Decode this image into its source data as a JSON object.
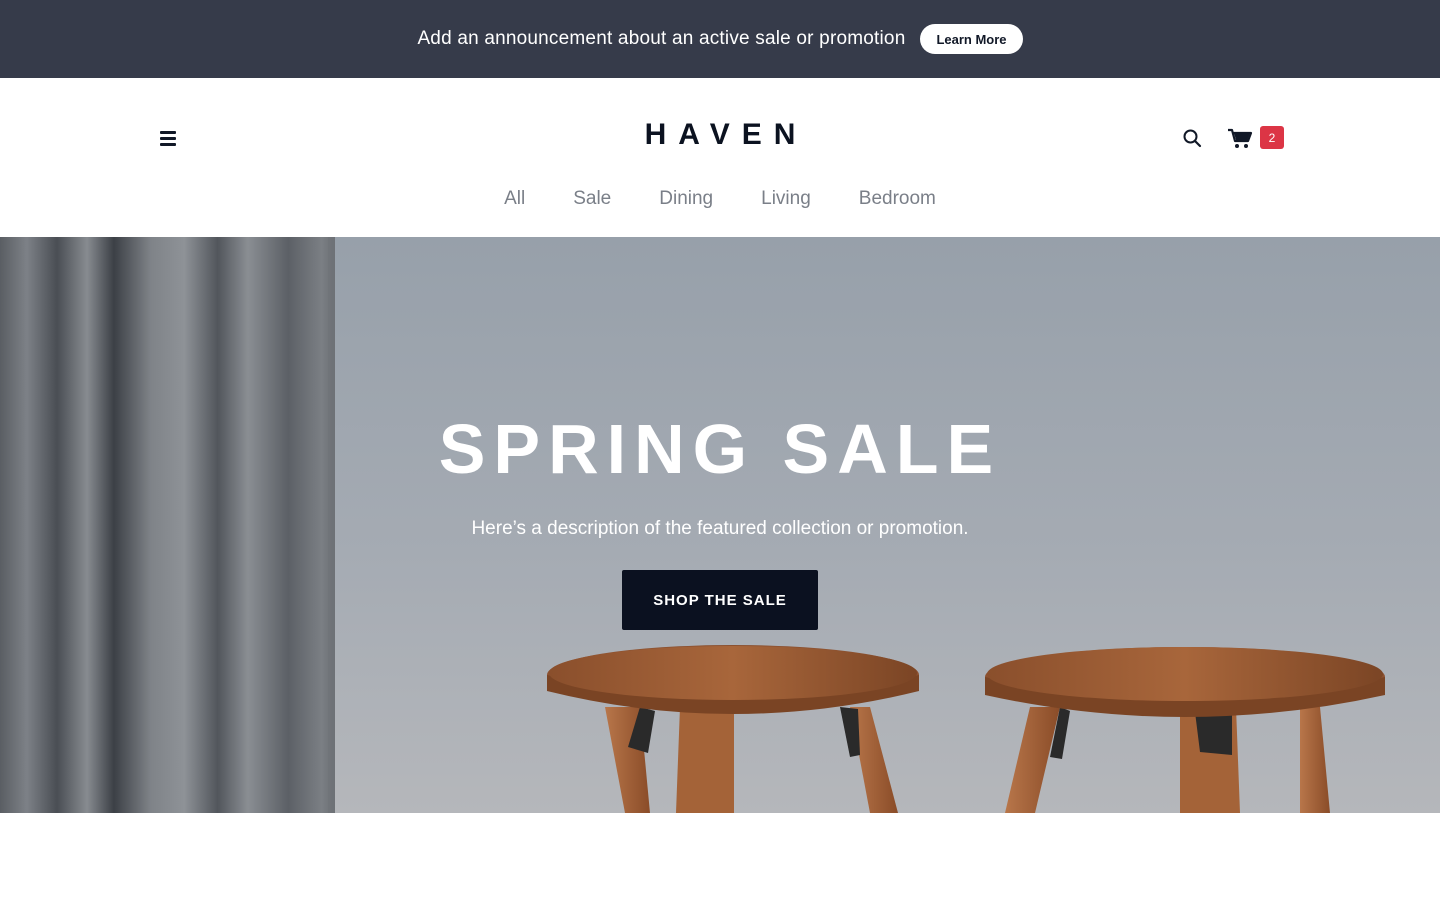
{
  "announcement": {
    "text": "Add an announcement about an active sale or promotion",
    "button_label": "Learn More"
  },
  "header": {
    "logo": "HAVEN",
    "cart_count": "2",
    "nav": [
      "All",
      "Sale",
      "Dining",
      "Living",
      "Bedroom"
    ]
  },
  "hero": {
    "title": "SPRING SALE",
    "description": "Here’s a description of the featured collection or promotion.",
    "button_label": "SHOP THE SALE"
  },
  "icons": {
    "menu": "hamburger-menu-icon",
    "search": "search-icon",
    "cart": "shopping-cart-icon"
  },
  "colors": {
    "announcement_bg": "#363b4a",
    "cart_badge": "#dc3545",
    "primary_button": "#0b1120",
    "nav_text": "#7a7f88"
  }
}
